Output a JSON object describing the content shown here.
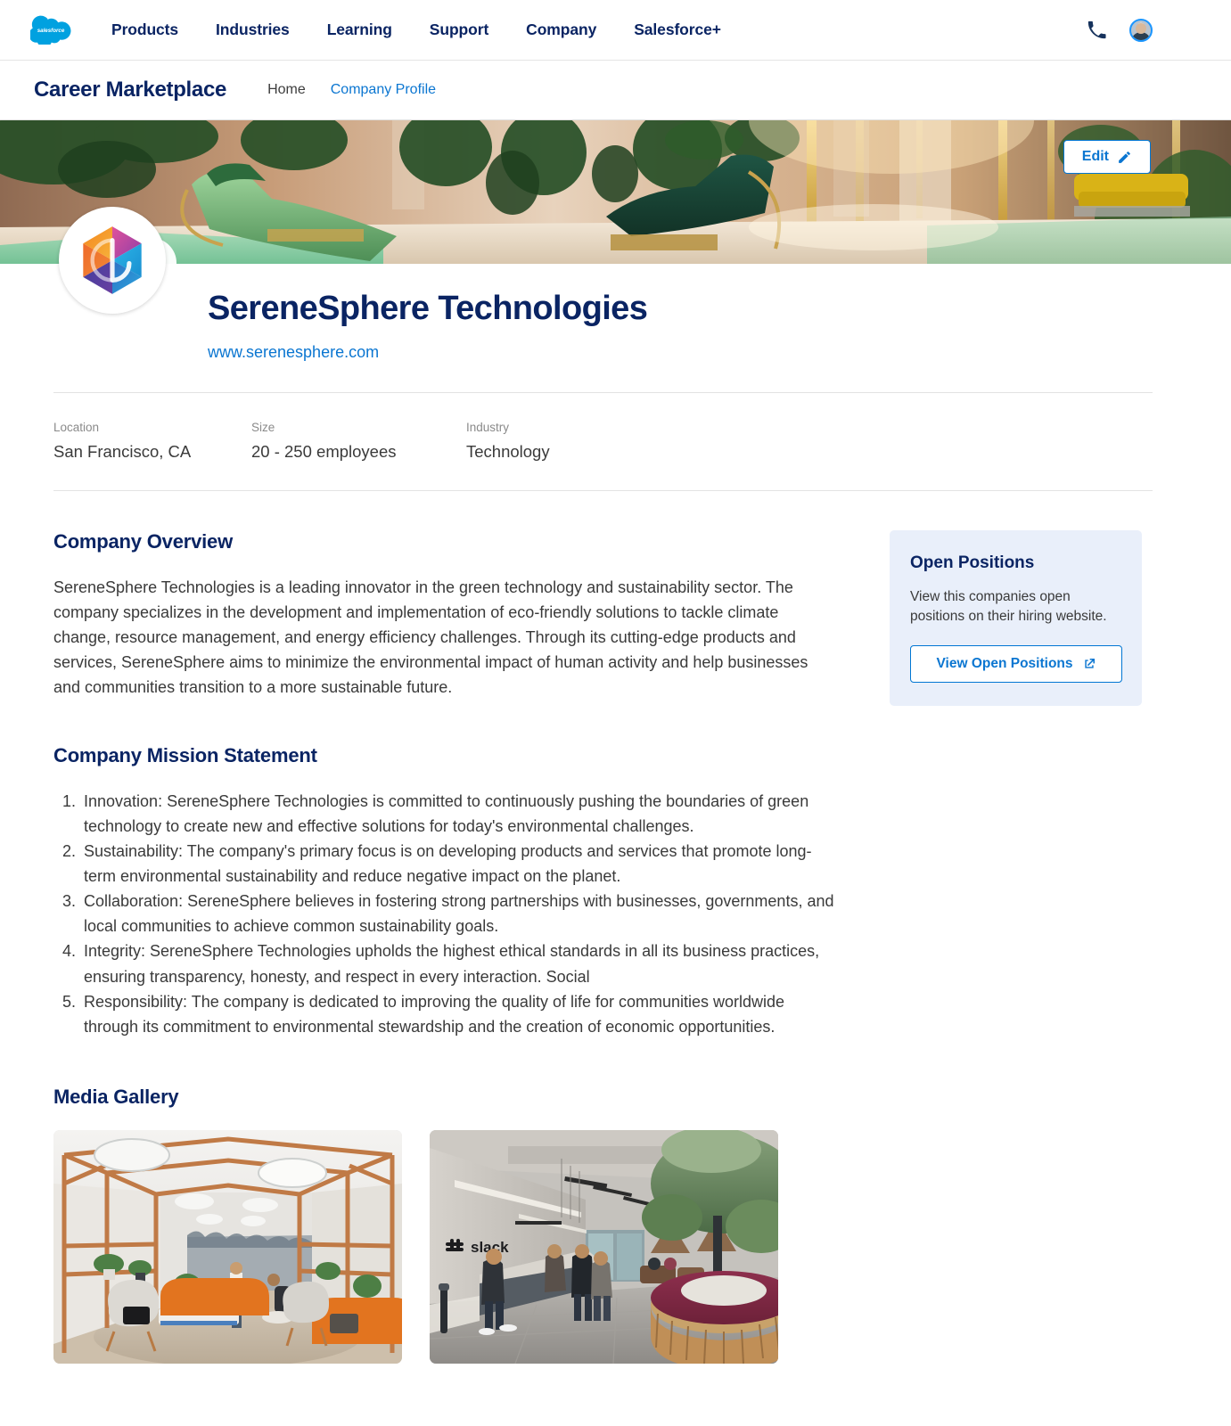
{
  "global_nav": {
    "logo": "salesforce-cloud-logo",
    "logo_text": "salesforce",
    "links": [
      {
        "label": "Products"
      },
      {
        "label": "Industries"
      },
      {
        "label": "Learning"
      },
      {
        "label": "Support"
      },
      {
        "label": "Company"
      },
      {
        "label": "Salesforce+"
      }
    ],
    "phone_icon": "phone-icon",
    "avatar_icon": "user-avatar"
  },
  "sub_nav": {
    "brand": "Career Marketplace",
    "links": [
      {
        "label": "Home",
        "active": false
      },
      {
        "label": "Company Profile",
        "active": true
      }
    ]
  },
  "hero": {
    "edit_button_label": "Edit",
    "edit_icon": "pencil-icon",
    "image_alt": "luxury-lounge-with-green-chaise-and-pool"
  },
  "profile": {
    "logo_alt": "serenesphere-hexagon-logo",
    "company_name": "SereneSphere Technologies",
    "website": "www.serenesphere.com"
  },
  "meta": [
    {
      "label": "Location",
      "value": "San Francisco, CA"
    },
    {
      "label": "Size",
      "value": "20 - 250 employees"
    },
    {
      "label": "Industry",
      "value": "Technology"
    }
  ],
  "overview": {
    "heading": "Company Overview",
    "body": "SereneSphere Technologies is a leading innovator in the green technology and sustainability sector. The company specializes in the development and implementation of eco-friendly solutions to tackle climate change, resource management, and energy efficiency challenges. Through its cutting-edge products and services, SereneSphere aims to minimize the environmental impact of human activity and help businesses and communities transition to a more sustainable future."
  },
  "mission": {
    "heading": "Company Mission Statement",
    "items": [
      "Innovation: SereneSphere Technologies is committed to continuously pushing the boundaries of green technology to create new and effective solutions for today's environmental challenges.",
      "Sustainability: The company's primary focus is on developing products and services that promote long-term environmental sustainability and reduce negative impact on the planet.",
      "Collaboration: SereneSphere believes in fostering strong partnerships with businesses, governments, and local communities to achieve common sustainability goals.",
      "Integrity: SereneSphere Technologies upholds the highest ethical standards in all its business practices, ensuring transparency, honesty, and respect in every interaction. Social",
      "Responsibility: The company is dedicated to improving the quality of life for communities worldwide through its commitment to environmental stewardship and the creation of economic opportunities."
    ]
  },
  "open_positions": {
    "title": "Open Positions",
    "description": "View this companies open positions on their hiring website.",
    "button_label": "View Open Positions",
    "button_icon": "external-link-icon"
  },
  "media_gallery": {
    "heading": "Media Gallery",
    "items": [
      {
        "alt": "office-lounge-with-wooden-frame-and-orange-sofas"
      },
      {
        "alt": "slack-office-lobby-with-reception-desk-and-tree"
      }
    ]
  },
  "colors": {
    "brand_navy": "#0a2463",
    "link_blue": "#0b76d1",
    "accent_blue": "#0176d3",
    "card_bg": "#e9effa",
    "text_gray": "#3a3a3a",
    "label_gray": "#8a8a8a"
  }
}
